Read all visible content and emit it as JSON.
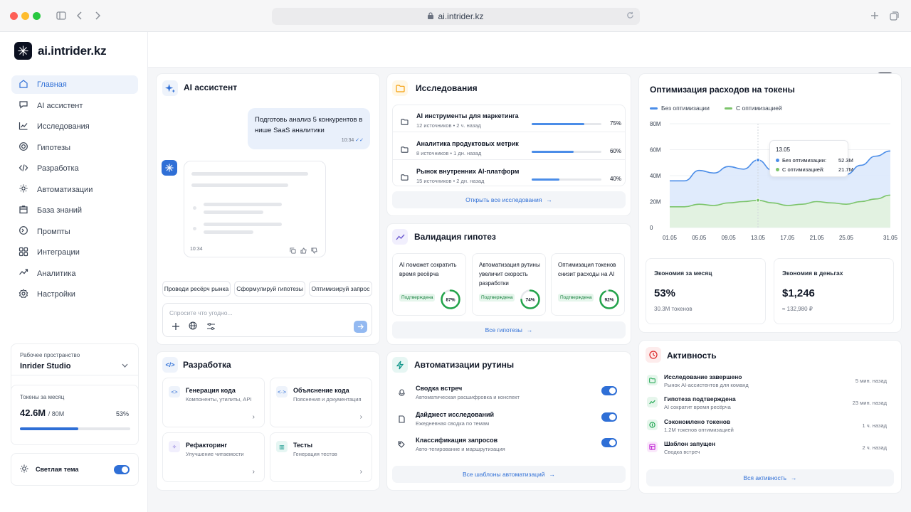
{
  "browser": {
    "url": "ai.intrider.kz"
  },
  "brand": {
    "name": "ai.intrider.kz"
  },
  "topbar": {
    "kbd": "⌘K"
  },
  "nav": [
    {
      "label": "Главная",
      "icon": "home-icon",
      "active": true
    },
    {
      "label": "AI ассистент",
      "icon": "chat-icon"
    },
    {
      "label": "Исследования",
      "icon": "chart-line-icon"
    },
    {
      "label": "Гипотезы",
      "icon": "target-icon"
    },
    {
      "label": "Разработка",
      "icon": "code-icon"
    },
    {
      "label": "Автоматизации",
      "icon": "gear-flow-icon"
    },
    {
      "label": "База знаний",
      "icon": "database-icon"
    },
    {
      "label": "Промпты",
      "icon": "prompt-icon"
    },
    {
      "label": "Интеграции",
      "icon": "grid-icon"
    },
    {
      "label": "Аналитика",
      "icon": "analytics-icon"
    },
    {
      "label": "Настройки",
      "icon": "settings-icon"
    }
  ],
  "workspace": {
    "label": "Рабочее пространство",
    "name": "Inrider Studio",
    "tokens_label": "Токены за месяц",
    "tokens_used": "42.6M",
    "tokens_total": "/ 80M",
    "tokens_pct": "53%",
    "tokens_fraction": 0.53
  },
  "theme": {
    "label": "Светлая тема"
  },
  "assistant": {
    "title": "AI ассистент",
    "user_message": "Подготовь анализ 5 конкурентов в нише SaaS аналитики",
    "user_time": "10:34",
    "ai_time": "10:34",
    "suggestions": [
      "Проведи ресёрч рынка",
      "Сформулируй гипотезы",
      "Оптимизируй запрос"
    ],
    "input_placeholder": "Спросите что угодно..."
  },
  "research": {
    "title": "Исследования",
    "items": [
      {
        "title": "AI инструменты для маркетинга",
        "meta": "12 источников  •  2 ч. назад",
        "progress": "75%",
        "fraction": 0.75
      },
      {
        "title": "Аналитика продуктовых метрик",
        "meta": "8 источников  •  1 дн. назад",
        "progress": "60%",
        "fraction": 0.6
      },
      {
        "title": "Рынок внутренних AI-платформ",
        "meta": "15 источников  •  2 дн. назад",
        "progress": "40%",
        "fraction": 0.4
      }
    ],
    "link": "Открыть все исследования"
  },
  "hypotheses": {
    "title": "Валидация гипотез",
    "items": [
      {
        "text": "AI поможет сократить время ресёрча",
        "badge": "Подтверждена",
        "score": "87%",
        "fraction": 0.87
      },
      {
        "text": "Автоматизация рутины увеличит скорость разработки",
        "badge": "Подтверждена",
        "score": "74%",
        "fraction": 0.74
      },
      {
        "text": "Оптимизация токенов снизит расходы на AI",
        "badge": "Подтверждена",
        "score": "92%",
        "fraction": 0.92
      }
    ],
    "link": "Все гипотезы"
  },
  "tokens_chart": {
    "title": "Оптимизация расходов на токены",
    "tooltip": {
      "date": "13.05",
      "a_label": "Без оптимизации:",
      "a_value": "52.3M",
      "b_label": "С оптимизацией:",
      "b_value": "21.7M"
    }
  },
  "chart_data": {
    "type": "area",
    "x": [
      "01.05",
      "03.05",
      "05.05",
      "07.05",
      "09.05",
      "11.05",
      "13.05",
      "15.05",
      "17.05",
      "19.05",
      "21.05",
      "23.05",
      "25.05",
      "27.05",
      "29.05",
      "31.05"
    ],
    "x_ticks": [
      "01.05",
      "05.05",
      "09.05",
      "13.05",
      "17.05",
      "21.05",
      "25.05",
      "31.05"
    ],
    "y_ticks": [
      "0",
      "20M",
      "40M",
      "60M",
      "80M"
    ],
    "ylim": [
      0,
      80
    ],
    "series": [
      {
        "name": "Без оптимизации",
        "color": "#4b8de8",
        "values": [
          36,
          36,
          44,
          42,
          47,
          45,
          52,
          44,
          41,
          40,
          43,
          47,
          41,
          48,
          55,
          59
        ]
      },
      {
        "name": "С оптимизацией",
        "color": "#7cc46b",
        "values": [
          16,
          16,
          18,
          17,
          19,
          20,
          21,
          19,
          17,
          18,
          20,
          19,
          18,
          20,
          22,
          25
        ]
      }
    ],
    "legend": "top-left",
    "grid": true
  },
  "stats": [
    {
      "label": "Экономия за месяц",
      "value": "53%",
      "sub": "30.3M токенов"
    },
    {
      "label": "Экономия в деньгах",
      "value": "$1,246",
      "sub": "≈ 132,980 ₽"
    }
  ],
  "dev": {
    "title": "Разработка",
    "items": [
      {
        "title": "Генерация кода",
        "sub": "Компоненты, утилиты, API",
        "icon": "<>"
      },
      {
        "title": "Объяснение кода",
        "sub": "Пояснения и документация",
        "icon": "<·>"
      },
      {
        "title": "Рефакторинг",
        "sub": "Улучшение читаемости",
        "icon": "✧"
      },
      {
        "title": "Тесты",
        "sub": "Генерация тестов",
        "icon": "▥"
      }
    ]
  },
  "automations": {
    "title": "Автоматизации рутины",
    "items": [
      {
        "title": "Сводка встреч",
        "sub": "Автоматическая расшифровка и конспект"
      },
      {
        "title": "Дайджест исследований",
        "sub": "Ежедневная сводка по темам"
      },
      {
        "title": "Классификация запросов",
        "sub": "Авто-тегирование и маршрутизация"
      }
    ],
    "link": "Все шаблоны автоматизаций"
  },
  "activity": {
    "title": "Активность",
    "items": [
      {
        "title": "Исследование завершено",
        "sub": "Рынок AI-ассистентов для команд",
        "time": "5 мин. назад",
        "color": "#16a34a",
        "bg": "#e6f6ec",
        "icon": "folder-icon"
      },
      {
        "title": "Гипотеза подтверждена",
        "sub": "AI сократит время ресёрча",
        "time": "23 мин. назад",
        "color": "#16a34a",
        "bg": "#e6f6ec",
        "icon": "trend-icon"
      },
      {
        "title": "Сэкономлено токенов",
        "sub": "1.2M токенов оптимизацией",
        "time": "1 ч. назад",
        "color": "#16a34a",
        "bg": "#e6f6ec",
        "icon": "coin-icon"
      },
      {
        "title": "Шаблон запущен",
        "sub": "Сводка встреч",
        "time": "2 ч. назад",
        "color": "#c026d3",
        "bg": "#fae8fb",
        "icon": "template-icon"
      }
    ],
    "link": "Вся активность"
  }
}
